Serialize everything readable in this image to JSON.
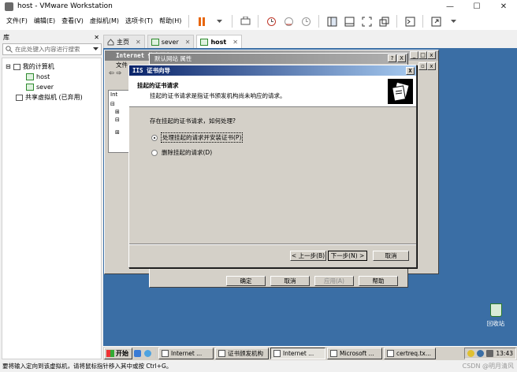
{
  "window": {
    "title": "host - VMware Workstation",
    "minimize_glyph": "—",
    "maximize_glyph": "☐",
    "close_glyph": "✕"
  },
  "menubar": {
    "items": [
      "文件(F)",
      "编辑(E)",
      "查看(V)",
      "虚拟机(M)",
      "选项卡(T)",
      "帮助(H)"
    ]
  },
  "library": {
    "title": "库",
    "close_glyph": "✕",
    "search_placeholder": "在此处键入内容进行搜索",
    "tree": {
      "root": "我的计算机",
      "vms": [
        "host",
        "sever"
      ],
      "shared": "共享虚拟机 (已弃用)"
    }
  },
  "tabs": [
    {
      "label": "主页",
      "icon": "home-icon"
    },
    {
      "label": "sever",
      "icon": "vm-icon"
    },
    {
      "label": "host",
      "icon": "vm-icon",
      "active": true
    }
  ],
  "iis_window": {
    "title": "Internet 信息服务",
    "menu_text": "文件",
    "tree_text": "Int"
  },
  "properties_dialog": {
    "title": "默认网站 属性",
    "help_glyph": "?",
    "close_glyph": "X",
    "buttons": {
      "ok": "确定",
      "cancel": "取消",
      "apply": "应用(A)",
      "help": "帮助"
    }
  },
  "wizard": {
    "title": "IIS 证书向导",
    "close_glyph": "X",
    "heading": "挂起的证书请求",
    "subheading": "挂起的证书请求是指证书颁发机构尚未响应的请求。",
    "question": "存在挂起的证书请求，如何处理?",
    "options": [
      {
        "label": "处理挂起的请求并安装证书(P)",
        "selected": true
      },
      {
        "label": "删除挂起的请求(D)",
        "selected": false
      }
    ],
    "buttons": {
      "back": "< 上一步(B)",
      "next": "下一步(N) >",
      "cancel": "取消"
    }
  },
  "desktop": {
    "recycle_bin": "回收站"
  },
  "taskbar": {
    "start": "开始",
    "tasks": [
      "Internet ...",
      "证书颁发机构",
      "Internet ...",
      "Microsoft ...",
      "certreq.tx..."
    ],
    "clock": "13:43"
  },
  "statusbar": {
    "text": "要将输入定向到该虚拟机，请将鼠标指针移入其中或按 Ctrl+G。",
    "watermark": "CSDN @明月清风"
  },
  "colors": {
    "guest_desktop": "#3a6ea5",
    "pause_accent": "#e8660d",
    "wizard_title": "#0a246a"
  }
}
